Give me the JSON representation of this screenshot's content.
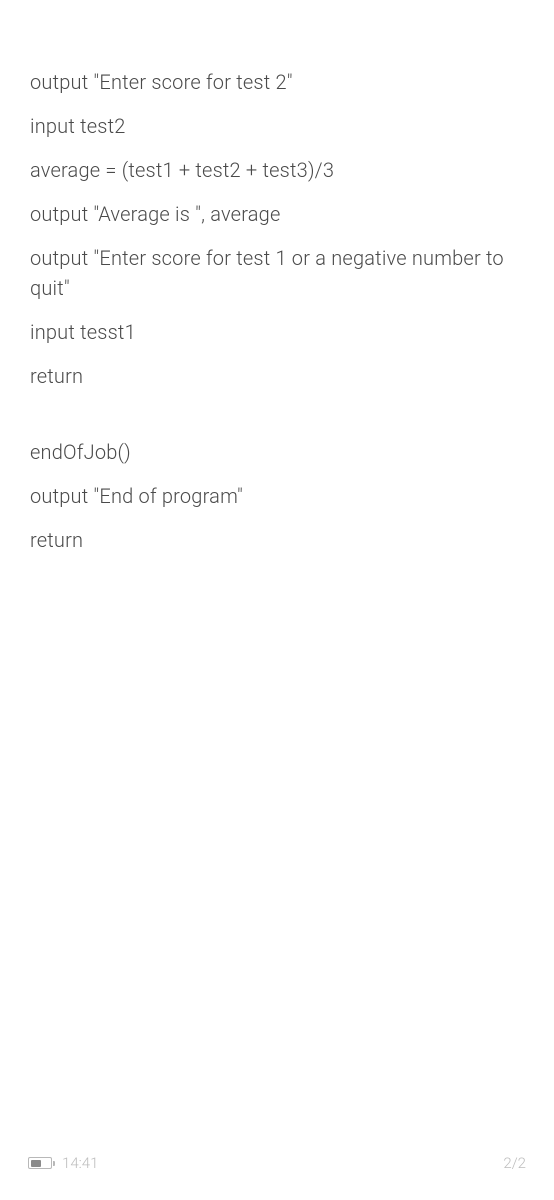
{
  "content": {
    "section1": {
      "line1": "output \"Enter score for test 2\"",
      "line2": "input test2",
      "line3": "average = (test1 + test2 + test3)/3",
      "line4": "output \"Average is \", average",
      "line5": "output \"Enter score for test 1 or a negative number to quit\"",
      "line6": "input tesst1",
      "line7": "return"
    },
    "section2": {
      "line1": "endOfJob()",
      "line2": "output \"End of program\"",
      "line3": "return"
    }
  },
  "status": {
    "time": "14:41",
    "page": "2/2"
  }
}
